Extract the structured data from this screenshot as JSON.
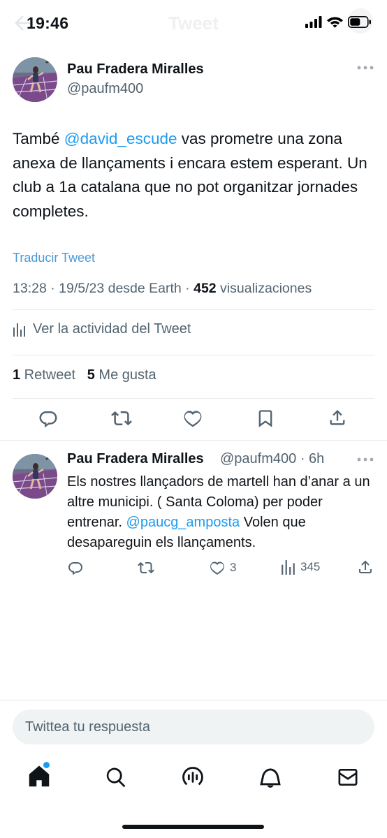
{
  "status_bar": {
    "time": "19:46",
    "faded_title": "Tweet"
  },
  "tweet": {
    "author_name": "Pau Fradera Miralles",
    "author_handle": "@paufm400",
    "text_before": "També ",
    "mention": "@david_escude",
    "text_after": " vas prometre una zona anexa de llançaments i encara estem esperant. Un club a 1a catalana que no pot organitzar jornades completes.",
    "translate_label": "Traducir Tweet",
    "timestamp": "13:28 · 19/5/23 desde Earth · ",
    "views_count": "452",
    "views_label": " visualizaciones",
    "activity_label": "Ver la actividad del Tweet",
    "retweets_count": "1",
    "retweets_label": " Retweet",
    "likes_count": "5",
    "likes_label": " Me gusta"
  },
  "reply": {
    "author_name": "Pau Fradera Miralles",
    "author_handle": "@paufm400 · 6h",
    "text_before": "Els nostres llançadors de martell han d’anar a un altre municipi. ( Santa Coloma) per poder entrenar. ",
    "mention": "@paucg_amposta",
    "text_after": "  Volen que desapareguin els llançaments.",
    "likes": "3",
    "views": "345"
  },
  "compose": {
    "placeholder": "Twittea tu respuesta"
  },
  "tab_bar": {
    "items": [
      "home-icon",
      "search-icon",
      "spaces-icon",
      "notifications-icon",
      "messages-icon"
    ]
  },
  "colors": {
    "accent": "#1d9bf0",
    "text": "#0f1419",
    "secondary": "#536471"
  }
}
